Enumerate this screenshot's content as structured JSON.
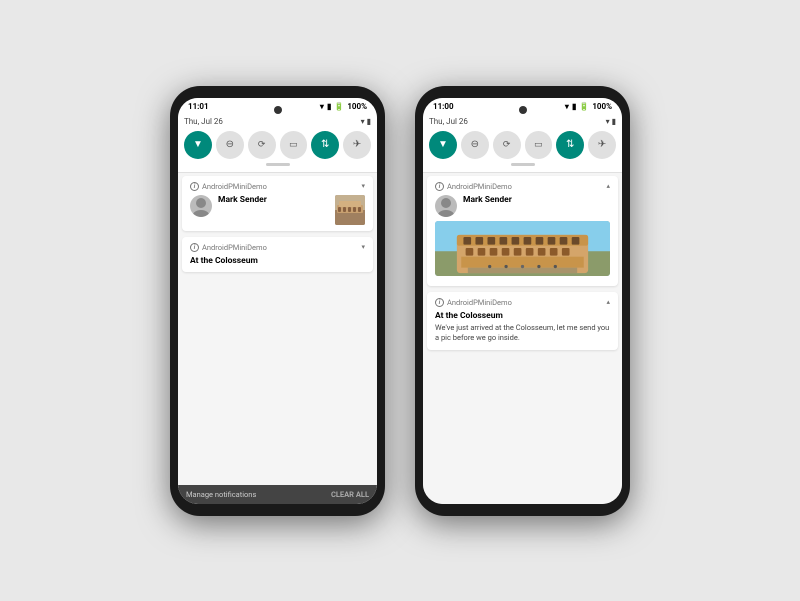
{
  "phone1": {
    "status_bar": {
      "time": "11:01",
      "battery": "100%"
    },
    "quick_settings": {
      "date": "Thu, Jul 26",
      "icons": [
        {
          "name": "wifi",
          "active": true,
          "symbol": "▼"
        },
        {
          "name": "dnd",
          "active": false,
          "symbol": "⊖"
        },
        {
          "name": "rotate",
          "active": false,
          "symbol": "⟳"
        },
        {
          "name": "battery_saver",
          "active": false,
          "symbol": "⬛"
        },
        {
          "name": "data_transfer",
          "active": true,
          "symbol": "⇅"
        },
        {
          "name": "airplane",
          "active": false,
          "symbol": "✈"
        }
      ]
    },
    "notifications": [
      {
        "app": "AndroidPMiniDemo",
        "collapsed": true,
        "sender": "Mark Sender",
        "has_image": true
      },
      {
        "app": "AndroidPMiniDemo",
        "collapsed": true,
        "title": "At the Colosseum",
        "has_image": false
      }
    ],
    "footer": {
      "manage": "Manage notifications",
      "clear": "CLEAR ALL"
    }
  },
  "phone2": {
    "status_bar": {
      "time": "11:00",
      "battery": "100%"
    },
    "quick_settings": {
      "date": "Thu, Jul 26"
    },
    "notifications": [
      {
        "app": "AndroidPMiniDemo",
        "collapsed": false,
        "sender": "Mark Sender",
        "has_image": true
      },
      {
        "app": "AndroidPMiniDemo",
        "collapsed": false,
        "title": "At the Colosseum",
        "body": "We've just arrived at the Colosseum, let me send you a pic before we go inside.",
        "has_image": false
      }
    ]
  }
}
